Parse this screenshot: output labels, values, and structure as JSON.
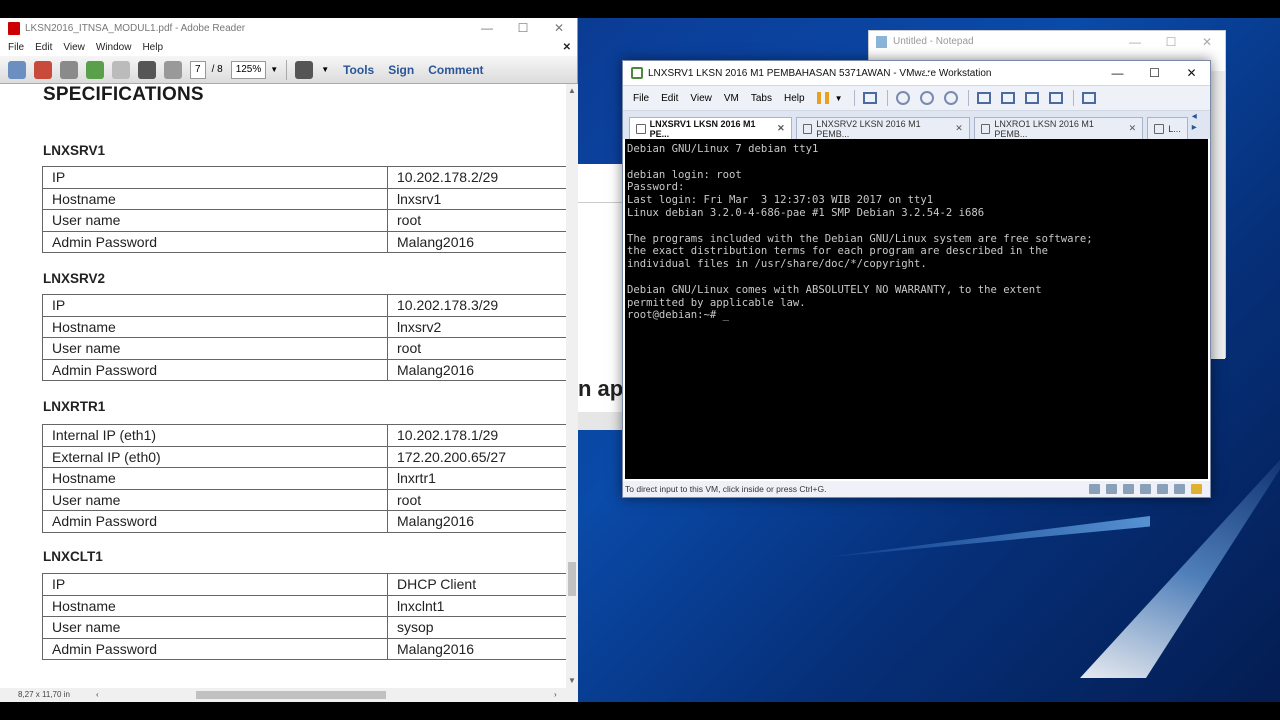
{
  "reader": {
    "title": "LKSN2016_ITNSA_MODUL1.pdf - Adobe Reader",
    "menu": [
      "File",
      "Edit",
      "View",
      "Window",
      "Help"
    ],
    "page_current": "7",
    "page_total": "/ 8",
    "zoom": "125%",
    "tools_label": "Tools",
    "sign_label": "Sign",
    "comment_label": "Comment",
    "page_size": "8,27 x 11,70 in",
    "doc": {
      "heading": "SPECIFICATIONS",
      "sections": [
        {
          "title": "LNXSRV1",
          "rows": [
            [
              "IP",
              "10.202.178.2/29"
            ],
            [
              "Hostname",
              "lnxsrv1"
            ],
            [
              "User name",
              "root"
            ],
            [
              "Admin Password",
              "Malang2016"
            ]
          ]
        },
        {
          "title": "LNXSRV2",
          "rows": [
            [
              "IP",
              "10.202.178.3/29"
            ],
            [
              "Hostname",
              "lnxsrv2"
            ],
            [
              "User name",
              "root"
            ],
            [
              "Admin Password",
              "Malang2016"
            ]
          ]
        },
        {
          "title": "LNXRTR1",
          "rows": [
            [
              "Internal IP (eth1)",
              "10.202.178.1/29"
            ],
            [
              "External IP (eth0)",
              "172.20.200.65/27"
            ],
            [
              "Hostname",
              "lnxrtr1"
            ],
            [
              "User name",
              "root"
            ],
            [
              "Admin Password",
              "Malang2016"
            ]
          ]
        },
        {
          "title": "LNXCLT1",
          "rows": [
            [
              "IP",
              "DHCP Client"
            ],
            [
              "Hostname",
              "lnxclnt1"
            ],
            [
              "User name",
              "sysop"
            ],
            [
              "Admin Password",
              "Malang2016"
            ]
          ]
        }
      ]
    }
  },
  "notepad": {
    "title": "Untitled - Notepad"
  },
  "background_doc": {
    "fragment": "n ap"
  },
  "vmware": {
    "title": "LNXSRV1 LKSN 2016 M1 PEMBAHASAN 5371AWAN - VMware Workstation",
    "menu": [
      "File",
      "Edit",
      "View",
      "VM",
      "Tabs",
      "Help"
    ],
    "tabs": [
      {
        "label": "LNXSRV1 LKSN 2016 M1 PE...",
        "active": true
      },
      {
        "label": "LNXSRV2 LKSN 2016 M1 PEMB...",
        "active": false
      },
      {
        "label": "LNXRO1 LKSN 2016 M1 PEMB...",
        "active": false
      },
      {
        "label": "L...",
        "active": false
      }
    ],
    "console": "Debian GNU/Linux 7 debian tty1\n\ndebian login: root\nPassword:\nLast login: Fri Mar  3 12:37:03 WIB 2017 on tty1\nLinux debian 3.2.0-4-686-pae #1 SMP Debian 3.2.54-2 i686\n\nThe programs included with the Debian GNU/Linux system are free software;\nthe exact distribution terms for each program are described in the\nindividual files in /usr/share/doc/*/copyright.\n\nDebian GNU/Linux comes with ABSOLUTELY NO WARRANTY, to the extent\npermitted by applicable law.\nroot@debian:~# _",
    "status": "To direct input to this VM, click inside or press Ctrl+G."
  },
  "window_controls": {
    "minimize": "—",
    "maximize": "☐",
    "close": "✕"
  }
}
